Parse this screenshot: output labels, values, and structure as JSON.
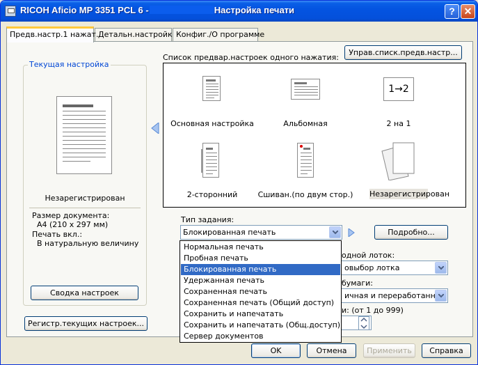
{
  "window": {
    "title_prefix": "RICOH Aficio MP 3351 PCL 6 -",
    "title_suffix": "Настройка печати",
    "help_glyph": "?",
    "close_glyph": "✕"
  },
  "tabs": [
    {
      "label": "Предв.настр.1 нажат."
    },
    {
      "label": "Детальн.настройки"
    },
    {
      "label": "Конфиг./О программе"
    }
  ],
  "current_settings": {
    "legend": "Текущая настройка",
    "preset_name": "Незарегистрирован",
    "doc_size_label": "Размер документа:",
    "doc_size_value": "A4 (210 x 297 мм)",
    "print_on_label": "Печать вкл.:",
    "print_on_value": "В натуральную величину",
    "summary_button": "Сводка настроек",
    "register_button": "Регистр.текущих настроек..."
  },
  "presets": {
    "list_label": "Список предвар.настроек одного нажатия:",
    "manage_button": "Управ.списк.предв.настр...",
    "items": [
      {
        "label": "Основная настройка",
        "icon": "portrait-page-icon"
      },
      {
        "label": "Альбомная",
        "icon": "landscape-page-icon"
      },
      {
        "label": "2 на 1",
        "icon": "two-in-one-icon",
        "icon_text": "1→2"
      },
      {
        "label": "2-сторонний",
        "icon": "duplex-page-icon"
      },
      {
        "label": "Сшиван.(по двум стор.)",
        "icon": "stapled-page-icon"
      },
      {
        "label": "Незарегистрирован",
        "icon": "blank-pages-icon"
      }
    ]
  },
  "job_type": {
    "label": "Тип задания:",
    "selected": "Блокированная печать",
    "details_button": "Подробно...",
    "options": [
      "Нормальная печать",
      "Пробная печать",
      "Блокированная печать",
      "Удержанная печать",
      "Сохраненная печать",
      "Сохраненная печать (Общий доступ)",
      "Сохранить и напечатать",
      "Сохранить и напечатать (Общ.доступ)",
      "Сервер документов"
    ]
  },
  "hidden_fields": {
    "tray_label_partial": "одной лоток:",
    "tray_value_partial": "овыбор лотка",
    "paper_label_partial": "бумаги:",
    "paper_value_partial": "ичная и переработанная",
    "copies_label_partial": "и: (от 1 до 999)"
  },
  "footer": {
    "ok": "OK",
    "cancel": "Отмена",
    "apply": "Применить",
    "help": "Справка"
  },
  "colors": {
    "title_bar": "#0454e1",
    "selection": "#316ac5",
    "legend_text": "#0046d5",
    "tab_highlight": "#ffc83c"
  }
}
